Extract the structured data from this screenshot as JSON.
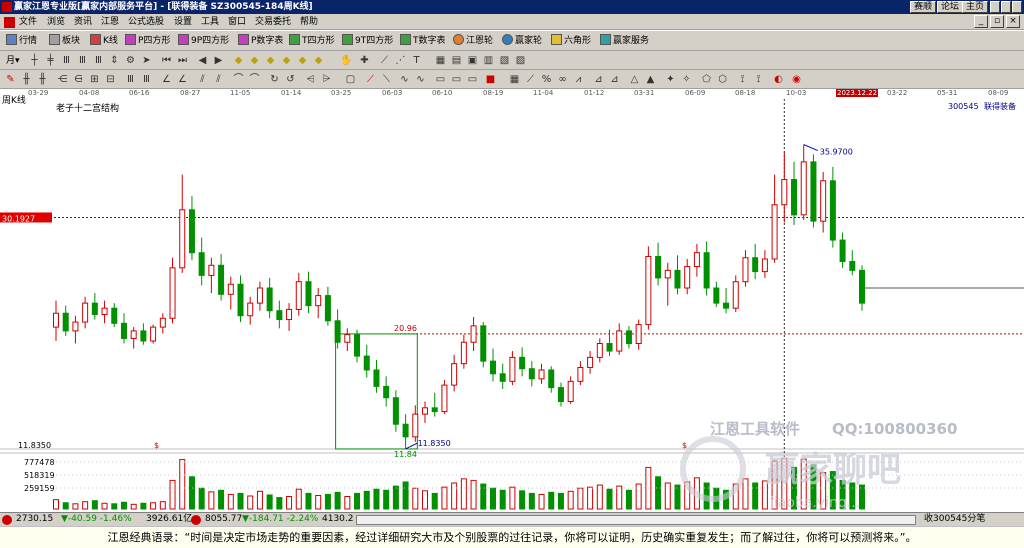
{
  "window": {
    "title": "赢家江恩专业版[赢家内部服务平台] - [联得装备  SZ300545-184周K线]",
    "btn_forum": "赛顺",
    "btn_bbs": "论坛",
    "btn_home": "主页"
  },
  "menu": [
    "文件",
    "浏览",
    "资讯",
    "江恩",
    "公式选股",
    "设置",
    "工具",
    "窗口",
    "交易委托",
    "帮助"
  ],
  "toolbar1": [
    {
      "label": "行情",
      "icon": "grid-icon"
    },
    {
      "label": "板块",
      "icon": "block-icon"
    },
    {
      "label": "K线",
      "icon": "kline-icon"
    },
    {
      "label": "P四方形",
      "icon": "p-square-icon"
    },
    {
      "label": "9P四方形",
      "icon": "p9-square-icon"
    },
    {
      "label": "P数字表",
      "icon": "p-table-icon"
    },
    {
      "label": "T四方形",
      "icon": "t-square-icon"
    },
    {
      "label": "9T四方形",
      "icon": "t9-square-icon"
    },
    {
      "label": "T数字表",
      "icon": "t-table-icon"
    },
    {
      "label": "江恩轮",
      "icon": "gann-wheel-icon"
    },
    {
      "label": "赢家轮",
      "icon": "winner-wheel-icon"
    },
    {
      "label": "六角形",
      "icon": "hexagon-icon"
    },
    {
      "label": "赢家服务",
      "icon": "service-icon"
    }
  ],
  "toolbar2_period": "月",
  "chart_header": {
    "period": "周K线",
    "pattern": "老子十二宫结构",
    "code": "300545",
    "name": "联得装备",
    "price_marker": "30.1927",
    "crosshair_date": "2023.12.22",
    "high_label": "35.9700",
    "level_label": "20.96",
    "low_label": "11.84",
    "low_label2": "11.8350",
    "axis_low": "11.8350",
    "dollar1": "$",
    "dollar2": "$"
  },
  "watermark": {
    "line1": "江恩工具软件",
    "qq": "QQ:100800360",
    "forum": "赢家聊吧",
    "url": "jiaoba.ying..."
  },
  "dates": [
    "03-29",
    "04-08",
    "06-16",
    "08-27",
    "11-05",
    "01-14",
    "03-25",
    "06-03",
    "06-10",
    "08-19",
    "11-04",
    "01-12",
    "03-31",
    "06-09",
    "08-18",
    "10-03",
    "2023.12.22",
    "03-22",
    "05-31",
    "08-09"
  ],
  "volume_axis": [
    "777478",
    "518319",
    "259159"
  ],
  "status": {
    "sh_index": "2730.15",
    "sh_change": "▼-40.59 -1.46%",
    "sh_amount": "3926.61亿",
    "sz_index": "8055.77",
    "sz_change": "▼-184.71 -2.24%",
    "sz_amount": "4130.2",
    "right": "收300545分笔"
  },
  "quote": "江恩经典语录：“时间是决定市场走势的重要因素，经过详细研究大市及个别股票的过往记录，你将可以证明，历史确实重复发生；而了解过往，你将可以预测将来。”。",
  "colors": {
    "up": "#d00000",
    "down": "#009000",
    "title": "#0a246a",
    "marker": "#e00000"
  },
  "chart_data": {
    "type": "candlestick",
    "ylim": [
      11.835,
      38.0
    ],
    "price_marker": 30.1927,
    "high": 35.97,
    "level": 20.96,
    "low": 11.84,
    "last": 24.6,
    "bars": [
      {
        "o": 21.5,
        "h": 23.6,
        "l": 20.4,
        "c": 22.6
      },
      {
        "o": 22.6,
        "h": 23.2,
        "l": 20.8,
        "c": 21.2
      },
      {
        "o": 21.2,
        "h": 22.4,
        "l": 20.2,
        "c": 21.9
      },
      {
        "o": 21.9,
        "h": 23.9,
        "l": 21.4,
        "c": 23.4
      },
      {
        "o": 23.4,
        "h": 24.2,
        "l": 22.1,
        "c": 22.5
      },
      {
        "o": 22.5,
        "h": 23.6,
        "l": 21.8,
        "c": 23.0
      },
      {
        "o": 23.0,
        "h": 23.4,
        "l": 21.5,
        "c": 21.8
      },
      {
        "o": 21.8,
        "h": 22.6,
        "l": 20.2,
        "c": 20.6
      },
      {
        "o": 20.6,
        "h": 21.5,
        "l": 19.8,
        "c": 21.2
      },
      {
        "o": 21.2,
        "h": 21.8,
        "l": 20.1,
        "c": 20.4
      },
      {
        "o": 20.4,
        "h": 21.7,
        "l": 20.2,
        "c": 21.5
      },
      {
        "o": 21.5,
        "h": 22.6,
        "l": 21.0,
        "c": 22.2
      },
      {
        "o": 22.2,
        "h": 27.0,
        "l": 21.8,
        "c": 26.2
      },
      {
        "o": 26.2,
        "h": 33.6,
        "l": 25.8,
        "c": 30.8
      },
      {
        "o": 30.8,
        "h": 31.9,
        "l": 26.8,
        "c": 27.4
      },
      {
        "o": 27.4,
        "h": 28.6,
        "l": 24.8,
        "c": 25.6
      },
      {
        "o": 25.6,
        "h": 27.0,
        "l": 24.2,
        "c": 26.4
      },
      {
        "o": 26.4,
        "h": 27.3,
        "l": 23.6,
        "c": 24.1
      },
      {
        "o": 24.1,
        "h": 25.5,
        "l": 22.9,
        "c": 24.9
      },
      {
        "o": 24.9,
        "h": 25.6,
        "l": 21.9,
        "c": 22.4
      },
      {
        "o": 22.4,
        "h": 23.9,
        "l": 21.7,
        "c": 23.4
      },
      {
        "o": 23.4,
        "h": 25.1,
        "l": 22.8,
        "c": 24.6
      },
      {
        "o": 24.6,
        "h": 25.4,
        "l": 22.2,
        "c": 22.8
      },
      {
        "o": 22.8,
        "h": 23.6,
        "l": 21.4,
        "c": 22.1
      },
      {
        "o": 22.1,
        "h": 23.4,
        "l": 21.2,
        "c": 22.9
      },
      {
        "o": 22.9,
        "h": 25.8,
        "l": 22.4,
        "c": 25.1
      },
      {
        "o": 25.1,
        "h": 25.9,
        "l": 22.6,
        "c": 23.2
      },
      {
        "o": 23.2,
        "h": 24.6,
        "l": 22.2,
        "c": 24.0
      },
      {
        "o": 24.0,
        "h": 24.7,
        "l": 21.6,
        "c": 22.0
      },
      {
        "o": 22.0,
        "h": 22.9,
        "l": 19.8,
        "c": 20.3
      },
      {
        "o": 20.3,
        "h": 21.4,
        "l": 19.6,
        "c": 20.9
      },
      {
        "o": 20.9,
        "h": 21.3,
        "l": 18.7,
        "c": 19.2
      },
      {
        "o": 19.2,
        "h": 20.1,
        "l": 17.5,
        "c": 18.1
      },
      {
        "o": 18.1,
        "h": 18.9,
        "l": 16.3,
        "c": 16.8
      },
      {
        "o": 16.8,
        "h": 17.6,
        "l": 15.2,
        "c": 15.9
      },
      {
        "o": 15.9,
        "h": 16.5,
        "l": 13.2,
        "c": 13.8
      },
      {
        "o": 13.8,
        "h": 14.6,
        "l": 11.84,
        "c": 12.8
      },
      {
        "o": 12.8,
        "h": 15.3,
        "l": 12.4,
        "c": 14.6
      },
      {
        "o": 14.6,
        "h": 15.6,
        "l": 13.9,
        "c": 15.1
      },
      {
        "o": 15.1,
        "h": 16.3,
        "l": 14.4,
        "c": 14.8
      },
      {
        "o": 14.8,
        "h": 17.3,
        "l": 14.6,
        "c": 16.9
      },
      {
        "o": 16.9,
        "h": 19.3,
        "l": 16.4,
        "c": 18.6
      },
      {
        "o": 18.6,
        "h": 20.9,
        "l": 18.2,
        "c": 20.3
      },
      {
        "o": 20.3,
        "h": 22.3,
        "l": 19.6,
        "c": 21.6
      },
      {
        "o": 21.6,
        "h": 21.9,
        "l": 18.3,
        "c": 18.8
      },
      {
        "o": 18.8,
        "h": 19.8,
        "l": 17.2,
        "c": 17.8
      },
      {
        "o": 17.8,
        "h": 18.6,
        "l": 16.6,
        "c": 17.2
      },
      {
        "o": 17.2,
        "h": 19.6,
        "l": 16.9,
        "c": 19.1
      },
      {
        "o": 19.1,
        "h": 19.9,
        "l": 17.6,
        "c": 18.2
      },
      {
        "o": 18.2,
        "h": 18.8,
        "l": 16.8,
        "c": 17.4
      },
      {
        "o": 17.4,
        "h": 18.6,
        "l": 17.0,
        "c": 18.1
      },
      {
        "o": 18.1,
        "h": 18.4,
        "l": 16.3,
        "c": 16.7
      },
      {
        "o": 16.7,
        "h": 17.1,
        "l": 15.2,
        "c": 15.6
      },
      {
        "o": 15.6,
        "h": 17.6,
        "l": 15.4,
        "c": 17.2
      },
      {
        "o": 17.2,
        "h": 18.8,
        "l": 16.9,
        "c": 18.3
      },
      {
        "o": 18.3,
        "h": 19.6,
        "l": 17.8,
        "c": 19.1
      },
      {
        "o": 19.1,
        "h": 20.6,
        "l": 18.7,
        "c": 20.2
      },
      {
        "o": 20.2,
        "h": 21.3,
        "l": 19.2,
        "c": 19.6
      },
      {
        "o": 19.6,
        "h": 21.8,
        "l": 19.3,
        "c": 21.2
      },
      {
        "o": 21.2,
        "h": 21.6,
        "l": 19.8,
        "c": 20.2
      },
      {
        "o": 20.2,
        "h": 22.1,
        "l": 19.7,
        "c": 21.7
      },
      {
        "o": 21.7,
        "h": 27.9,
        "l": 21.3,
        "c": 27.1
      },
      {
        "o": 27.1,
        "h": 28.2,
        "l": 24.8,
        "c": 25.4
      },
      {
        "o": 25.4,
        "h": 26.6,
        "l": 23.2,
        "c": 26.0
      },
      {
        "o": 26.0,
        "h": 27.2,
        "l": 24.1,
        "c": 24.6
      },
      {
        "o": 24.6,
        "h": 26.9,
        "l": 24.1,
        "c": 26.3
      },
      {
        "o": 26.3,
        "h": 28.1,
        "l": 25.5,
        "c": 27.4
      },
      {
        "o": 27.4,
        "h": 28.3,
        "l": 24.0,
        "c": 24.6
      },
      {
        "o": 24.6,
        "h": 25.1,
        "l": 23.1,
        "c": 23.4
      },
      {
        "o": 23.4,
        "h": 24.6,
        "l": 22.6,
        "c": 23.0
      },
      {
        "o": 23.0,
        "h": 25.6,
        "l": 22.7,
        "c": 25.1
      },
      {
        "o": 25.1,
        "h": 27.6,
        "l": 24.7,
        "c": 27.0
      },
      {
        "o": 27.0,
        "h": 28.1,
        "l": 25.3,
        "c": 25.9
      },
      {
        "o": 25.9,
        "h": 27.6,
        "l": 25.4,
        "c": 26.9
      },
      {
        "o": 26.9,
        "h": 33.6,
        "l": 26.6,
        "c": 31.2
      },
      {
        "o": 31.2,
        "h": 35.4,
        "l": 29.8,
        "c": 33.2
      },
      {
        "o": 33.2,
        "h": 34.6,
        "l": 29.6,
        "c": 30.4
      },
      {
        "o": 30.4,
        "h": 35.97,
        "l": 30.0,
        "c": 34.6
      },
      {
        "o": 34.6,
        "h": 35.2,
        "l": 29.4,
        "c": 29.9
      },
      {
        "o": 29.9,
        "h": 33.8,
        "l": 29.0,
        "c": 33.1
      },
      {
        "o": 33.1,
        "h": 34.2,
        "l": 27.8,
        "c": 28.4
      },
      {
        "o": 28.4,
        "h": 29.0,
        "l": 26.2,
        "c": 26.7
      },
      {
        "o": 26.7,
        "h": 27.6,
        "l": 25.6,
        "c": 26.0
      },
      {
        "o": 26.0,
        "h": 26.4,
        "l": 22.8,
        "c": 23.4
      }
    ],
    "volumes": [
      0.18,
      0.12,
      0.1,
      0.14,
      0.16,
      0.11,
      0.1,
      0.13,
      0.09,
      0.11,
      0.12,
      0.14,
      0.55,
      0.95,
      0.62,
      0.4,
      0.33,
      0.36,
      0.28,
      0.3,
      0.25,
      0.34,
      0.27,
      0.22,
      0.24,
      0.38,
      0.3,
      0.26,
      0.28,
      0.32,
      0.24,
      0.3,
      0.34,
      0.38,
      0.36,
      0.44,
      0.52,
      0.4,
      0.35,
      0.3,
      0.42,
      0.5,
      0.58,
      0.55,
      0.48,
      0.4,
      0.36,
      0.42,
      0.35,
      0.3,
      0.28,
      0.32,
      0.3,
      0.34,
      0.4,
      0.42,
      0.46,
      0.38,
      0.44,
      0.36,
      0.48,
      0.8,
      0.62,
      0.5,
      0.46,
      0.52,
      0.6,
      0.5,
      0.4,
      0.36,
      0.48,
      0.58,
      0.5,
      0.54,
      0.92,
      0.98,
      0.8,
      0.96,
      0.85,
      0.7,
      0.72,
      0.55,
      0.5,
      0.46
    ]
  }
}
